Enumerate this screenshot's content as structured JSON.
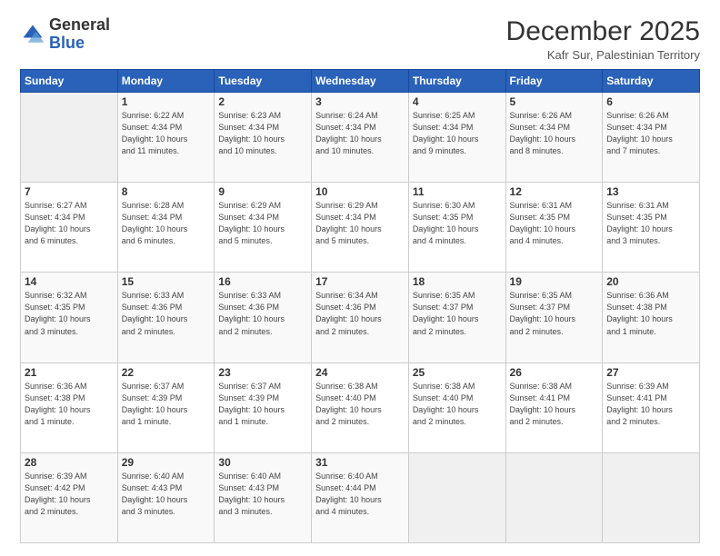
{
  "header": {
    "logo": {
      "general": "General",
      "blue": "Blue"
    },
    "title": "December 2025",
    "subtitle": "Kafr Sur, Palestinian Territory"
  },
  "calendar": {
    "days_of_week": [
      "Sunday",
      "Monday",
      "Tuesday",
      "Wednesday",
      "Thursday",
      "Friday",
      "Saturday"
    ],
    "weeks": [
      [
        {
          "day": "",
          "info": ""
        },
        {
          "day": "1",
          "info": "Sunrise: 6:22 AM\nSunset: 4:34 PM\nDaylight: 10 hours\nand 11 minutes."
        },
        {
          "day": "2",
          "info": "Sunrise: 6:23 AM\nSunset: 4:34 PM\nDaylight: 10 hours\nand 10 minutes."
        },
        {
          "day": "3",
          "info": "Sunrise: 6:24 AM\nSunset: 4:34 PM\nDaylight: 10 hours\nand 10 minutes."
        },
        {
          "day": "4",
          "info": "Sunrise: 6:25 AM\nSunset: 4:34 PM\nDaylight: 10 hours\nand 9 minutes."
        },
        {
          "day": "5",
          "info": "Sunrise: 6:26 AM\nSunset: 4:34 PM\nDaylight: 10 hours\nand 8 minutes."
        },
        {
          "day": "6",
          "info": "Sunrise: 6:26 AM\nSunset: 4:34 PM\nDaylight: 10 hours\nand 7 minutes."
        }
      ],
      [
        {
          "day": "7",
          "info": "Sunrise: 6:27 AM\nSunset: 4:34 PM\nDaylight: 10 hours\nand 6 minutes."
        },
        {
          "day": "8",
          "info": "Sunrise: 6:28 AM\nSunset: 4:34 PM\nDaylight: 10 hours\nand 6 minutes."
        },
        {
          "day": "9",
          "info": "Sunrise: 6:29 AM\nSunset: 4:34 PM\nDaylight: 10 hours\nand 5 minutes."
        },
        {
          "day": "10",
          "info": "Sunrise: 6:29 AM\nSunset: 4:34 PM\nDaylight: 10 hours\nand 5 minutes."
        },
        {
          "day": "11",
          "info": "Sunrise: 6:30 AM\nSunset: 4:35 PM\nDaylight: 10 hours\nand 4 minutes."
        },
        {
          "day": "12",
          "info": "Sunrise: 6:31 AM\nSunset: 4:35 PM\nDaylight: 10 hours\nand 4 minutes."
        },
        {
          "day": "13",
          "info": "Sunrise: 6:31 AM\nSunset: 4:35 PM\nDaylight: 10 hours\nand 3 minutes."
        }
      ],
      [
        {
          "day": "14",
          "info": "Sunrise: 6:32 AM\nSunset: 4:35 PM\nDaylight: 10 hours\nand 3 minutes."
        },
        {
          "day": "15",
          "info": "Sunrise: 6:33 AM\nSunset: 4:36 PM\nDaylight: 10 hours\nand 2 minutes."
        },
        {
          "day": "16",
          "info": "Sunrise: 6:33 AM\nSunset: 4:36 PM\nDaylight: 10 hours\nand 2 minutes."
        },
        {
          "day": "17",
          "info": "Sunrise: 6:34 AM\nSunset: 4:36 PM\nDaylight: 10 hours\nand 2 minutes."
        },
        {
          "day": "18",
          "info": "Sunrise: 6:35 AM\nSunset: 4:37 PM\nDaylight: 10 hours\nand 2 minutes."
        },
        {
          "day": "19",
          "info": "Sunrise: 6:35 AM\nSunset: 4:37 PM\nDaylight: 10 hours\nand 2 minutes."
        },
        {
          "day": "20",
          "info": "Sunrise: 6:36 AM\nSunset: 4:38 PM\nDaylight: 10 hours\nand 1 minute."
        }
      ],
      [
        {
          "day": "21",
          "info": "Sunrise: 6:36 AM\nSunset: 4:38 PM\nDaylight: 10 hours\nand 1 minute."
        },
        {
          "day": "22",
          "info": "Sunrise: 6:37 AM\nSunset: 4:39 PM\nDaylight: 10 hours\nand 1 minute."
        },
        {
          "day": "23",
          "info": "Sunrise: 6:37 AM\nSunset: 4:39 PM\nDaylight: 10 hours\nand 1 minute."
        },
        {
          "day": "24",
          "info": "Sunrise: 6:38 AM\nSunset: 4:40 PM\nDaylight: 10 hours\nand 2 minutes."
        },
        {
          "day": "25",
          "info": "Sunrise: 6:38 AM\nSunset: 4:40 PM\nDaylight: 10 hours\nand 2 minutes."
        },
        {
          "day": "26",
          "info": "Sunrise: 6:38 AM\nSunset: 4:41 PM\nDaylight: 10 hours\nand 2 minutes."
        },
        {
          "day": "27",
          "info": "Sunrise: 6:39 AM\nSunset: 4:41 PM\nDaylight: 10 hours\nand 2 minutes."
        }
      ],
      [
        {
          "day": "28",
          "info": "Sunrise: 6:39 AM\nSunset: 4:42 PM\nDaylight: 10 hours\nand 2 minutes."
        },
        {
          "day": "29",
          "info": "Sunrise: 6:40 AM\nSunset: 4:43 PM\nDaylight: 10 hours\nand 3 minutes."
        },
        {
          "day": "30",
          "info": "Sunrise: 6:40 AM\nSunset: 4:43 PM\nDaylight: 10 hours\nand 3 minutes."
        },
        {
          "day": "31",
          "info": "Sunrise: 6:40 AM\nSunset: 4:44 PM\nDaylight: 10 hours\nand 4 minutes."
        },
        {
          "day": "",
          "info": ""
        },
        {
          "day": "",
          "info": ""
        },
        {
          "day": "",
          "info": ""
        }
      ]
    ]
  }
}
